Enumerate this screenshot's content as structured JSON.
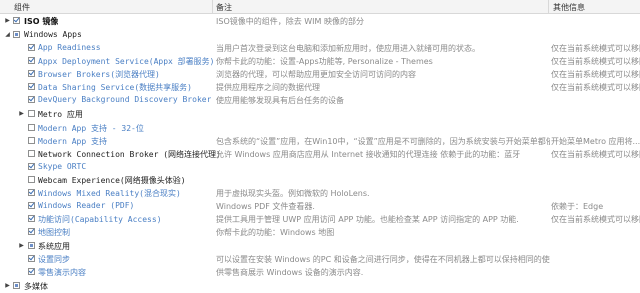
{
  "header": {
    "col_name": "组件",
    "col_desc": "备注",
    "col_other": "其他信息"
  },
  "rows": [
    {
      "name": "ISO 镜像",
      "desc": "ISO镜像中的组件，除去 WIM 映像的部分",
      "other": ""
    },
    {
      "name": "Windows Apps",
      "desc": "",
      "other": ""
    },
    {
      "name": "App Readiness",
      "desc": "当用户首次登录到这台电脑和添加新应用时，使应用进入就绪可用的状态。",
      "other": "仅在当前系统模式可以移除"
    },
    {
      "name": "Appx Deployment Service(Appx 部署服务)",
      "desc": "你帮卡此的功能：设置-Apps功能等, Personalize - Themes",
      "other": "仅在当前系统模式可以移除"
    },
    {
      "name": "Browser Brokers(浏览器代理)",
      "desc": "浏览器的代理，可以帮助应用更加安全访问可访问的内容",
      "other": "仅在当前系统模式可以移除"
    },
    {
      "name": "Data Sharing Service(数据共享服务)",
      "desc": "提供应用程序之间的数据代理",
      "other": "仅在当前系统模式可以移除"
    },
    {
      "name": "DevQuery Background Discovery Broker",
      "desc": "使应用能够发现具有后台任务的设备",
      "other": ""
    },
    {
      "name": "Metro 应用",
      "desc": "",
      "other": ""
    },
    {
      "name": "Modern App 支持 - 32-位",
      "desc": "",
      "other": ""
    },
    {
      "name": "Modern App 支持",
      "desc": "包含系统的“设置”应用，在Win10中，“设置”应用是不可删除的，因为系统安装与开始菜单都依赖...",
      "other": "开始菜单Metro 应用将..."
    },
    {
      "name": "Network Connection Broker (网络连接代理)",
      "desc": "允许 Windows 应用商店应用从 Internet 接收通知的代理连接  依赖于此的功能：蓝牙",
      "other": "仅在当前系统模式可以移除"
    },
    {
      "name": "Skype ORTC",
      "desc": "",
      "other": ""
    },
    {
      "name": "Webcam Experience(网络摄像头体验)",
      "desc": "",
      "other": ""
    },
    {
      "name": "Windows Mixed Reality(混合现实)",
      "desc": "用于虚拟现实头盔。例如微软的 HoloLens.",
      "other": ""
    },
    {
      "name": "Windows Reader (PDF)",
      "desc": "Windows PDF 文件查看器.",
      "other": "依赖于：Edge"
    },
    {
      "name": "功能访问(Capability Access)",
      "desc": "提供工具用于管理 UWP 应用访问 APP 功能。也能检查某 APP 访问指定的 APP 功能.",
      "other": "仅在当前系统模式可以移除"
    },
    {
      "name": "地图控制",
      "desc": "你帮卡此的功能：Windows 地图",
      "other": ""
    },
    {
      "name": "系统应用",
      "desc": "",
      "other": ""
    },
    {
      "name": "设置同步",
      "desc": "可以设置在安装 Windows 的PC 和设备之间进行同步，使得在不同机器上都可以保持相同的使用体验...",
      "other": ""
    },
    {
      "name": "零售演示内容",
      "desc": "供零售商展示 Windows 设备的演示内容.",
      "other": ""
    },
    {
      "name": "多媒体",
      "desc": "",
      "other": ""
    }
  ]
}
